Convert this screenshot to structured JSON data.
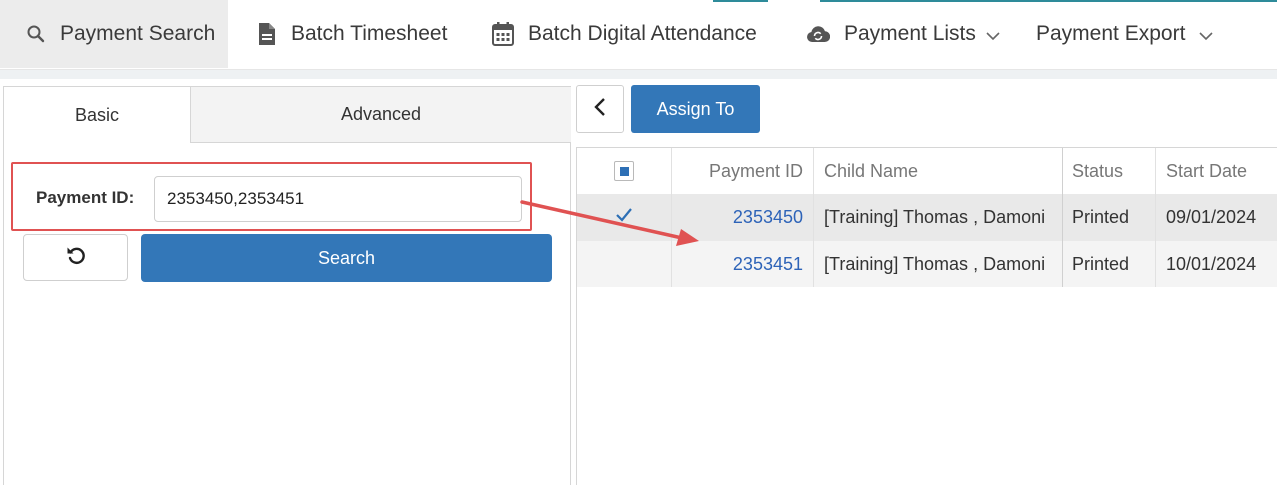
{
  "nav": {
    "items": [
      {
        "label": "Payment Search",
        "icon": "search-icon"
      },
      {
        "label": "Batch Timesheet",
        "icon": "document-icon"
      },
      {
        "label": "Batch Digital Attendance",
        "icon": "calendar-icon"
      },
      {
        "label": "Payment Lists",
        "icon": "cloud-sync-icon"
      },
      {
        "label": "Payment Export"
      }
    ]
  },
  "search_panel": {
    "tabs": {
      "basic": "Basic",
      "advanced": "Advanced"
    },
    "payment_id_label": "Payment ID:",
    "payment_id_value": "2353450,2353451",
    "search_label": "Search"
  },
  "results": {
    "assign_label": "Assign To",
    "columns": {
      "payment_id": "Payment ID",
      "child_name": "Child Name",
      "status": "Status",
      "start_date": "Start Date"
    },
    "rows": [
      {
        "payment_id": "2353450",
        "child_name": "[Training] Thomas , Damoni",
        "status": "Printed",
        "start_date": "09/01/2024",
        "checked": true
      },
      {
        "payment_id": "2353451",
        "child_name": "[Training] Thomas , Damoni",
        "status": "Printed",
        "start_date": "10/01/2024",
        "checked": false
      }
    ]
  },
  "colors": {
    "primary_button": "#3377b8",
    "link": "#2d63b8",
    "annotation": "#e05252",
    "nav_accent": "#2e8b9a"
  }
}
